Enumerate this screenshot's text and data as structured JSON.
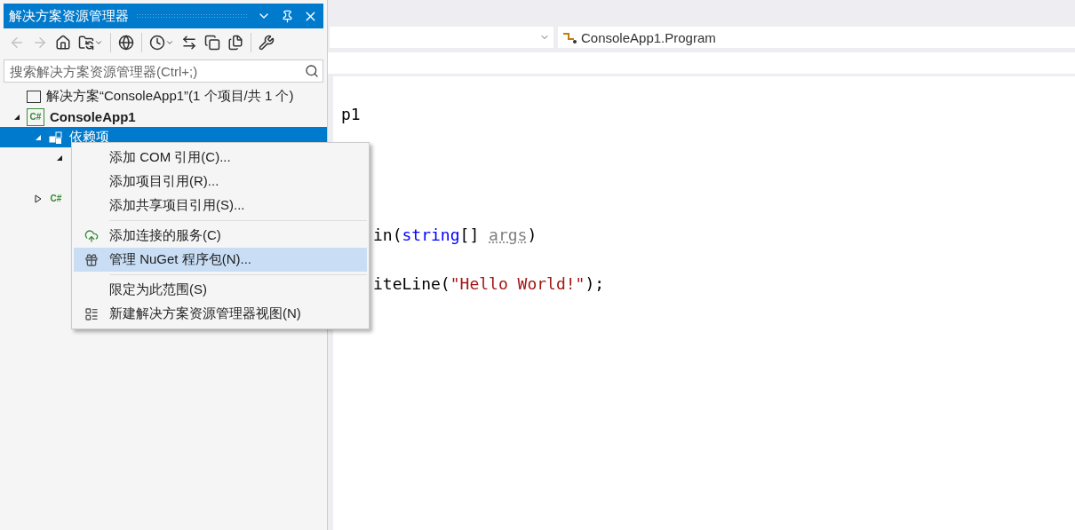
{
  "panel": {
    "title": "解决方案资源管理器",
    "toolbar": [
      {
        "kind": "back",
        "disabled": true
      },
      {
        "kind": "forward",
        "disabled": true
      },
      {
        "kind": "home",
        "disabled": false
      },
      {
        "kind": "sync",
        "disabled": false,
        "dropdown": true
      },
      {
        "kind": "sep"
      },
      {
        "kind": "globe",
        "disabled": false
      },
      {
        "kind": "sep"
      },
      {
        "kind": "history",
        "disabled": false,
        "dropdown": true
      },
      {
        "kind": "switch",
        "disabled": false
      },
      {
        "kind": "collapse",
        "disabled": false
      },
      {
        "kind": "copy",
        "disabled": false
      },
      {
        "kind": "sep"
      },
      {
        "kind": "wrench",
        "disabled": false
      }
    ],
    "search": {
      "placeholder": "搜索解决方案资源管理器(Ctrl+;)"
    },
    "tree": [
      {
        "kind": "solution",
        "label": "解决方案“ConsoleApp1”(1 个项目/共 1 个)",
        "selected": false,
        "children": [
          {
            "kind": "project",
            "icon_text": "C#",
            "label": "ConsoleApp1",
            "selected": false,
            "expanded": true,
            "children": [
              {
                "kind": "deps",
                "label": "依赖项",
                "selected": true,
                "expanded": true,
                "children": [
                  {
                    "selected": false,
                    "expanded": true,
                    "children": [
                      {
                        "selected": false
                      }
                    ]
                  }
                ]
              },
              {
                "kind": "csfile",
                "icon_text": "C#",
                "selected": false,
                "expanded": false
              }
            ]
          }
        ]
      }
    ]
  },
  "nav": {
    "right_dropdown": "ConsoleApp1.Program"
  },
  "code": [
    {
      "kind": "text",
      "covered_left": false,
      "segments": [
        {
          "kind": "plain",
          "text": "p1"
        }
      ]
    },
    {
      "kind": "blank"
    },
    {
      "kind": "blank"
    },
    {
      "kind": "blank"
    },
    {
      "kind": "blank"
    },
    {
      "kind": "text",
      "covered_left": true,
      "segments": [
        {
          "kind": "plain",
          "text": "in("
        },
        {
          "kind": "keyword",
          "text": "string"
        },
        {
          "kind": "plain",
          "text": "[] "
        },
        {
          "kind": "param",
          "text": "args"
        },
        {
          "kind": "plain",
          "text": ")"
        }
      ]
    },
    {
      "kind": "blank"
    },
    {
      "kind": "text",
      "covered_left": true,
      "segments": [
        {
          "kind": "plain",
          "text": "iteLine("
        },
        {
          "kind": "string",
          "text": "\"Hello World!\""
        },
        {
          "kind": "plain",
          "text": ");"
        }
      ]
    }
  ],
  "context_menu": [
    {
      "kind": "item",
      "label": "添加 COM 引用(C)...",
      "selected": false
    },
    {
      "kind": "item",
      "label": "添加项目引用(R)...",
      "selected": false
    },
    {
      "kind": "item",
      "label": "添加共享项目引用(S)...",
      "selected": false
    },
    {
      "kind": "separator"
    },
    {
      "kind": "item",
      "label": "添加连接的服务(C)",
      "selected": false
    },
    {
      "kind": "item",
      "label": "管理 NuGet 程序包(N)...",
      "selected": true
    },
    {
      "kind": "separator"
    },
    {
      "kind": "item",
      "label": "限定为此范围(S)",
      "selected": false
    },
    {
      "kind": "item",
      "label": "新建解决方案资源管理器视图(N)",
      "selected": false
    }
  ]
}
